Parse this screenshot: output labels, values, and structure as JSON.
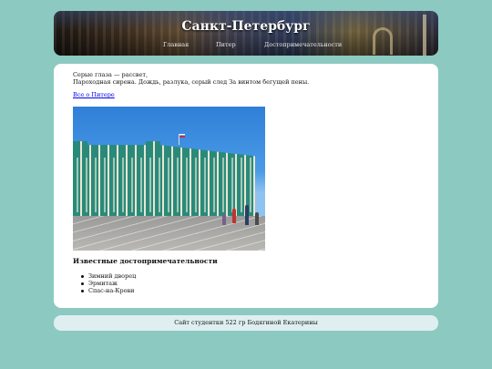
{
  "header": {
    "title": "Санкт-Петербург",
    "nav": [
      "Главная",
      "Питер",
      "Достопримечательности"
    ]
  },
  "main": {
    "intro_line1": "Серые глаза — рассвет,",
    "intro_line2": "Пароходная сирена. Дождь, разлука, серый след За винтом бегущей пены.",
    "link": "Все о Питере",
    "image_subject": "winter-palace-photo",
    "section_title": "Известные достопримечательности",
    "places": [
      "Зимний дворец",
      "Эрмитаж",
      "Спас-на-Крови"
    ]
  },
  "footer": {
    "text": "Сайт студентки 522 гр Бодягиной Екатерины"
  },
  "colors": {
    "page_bg": "#8cc9c1",
    "card_bg": "#ffffff",
    "footer_bg": "#dfeff1",
    "link": "#0000ee"
  }
}
